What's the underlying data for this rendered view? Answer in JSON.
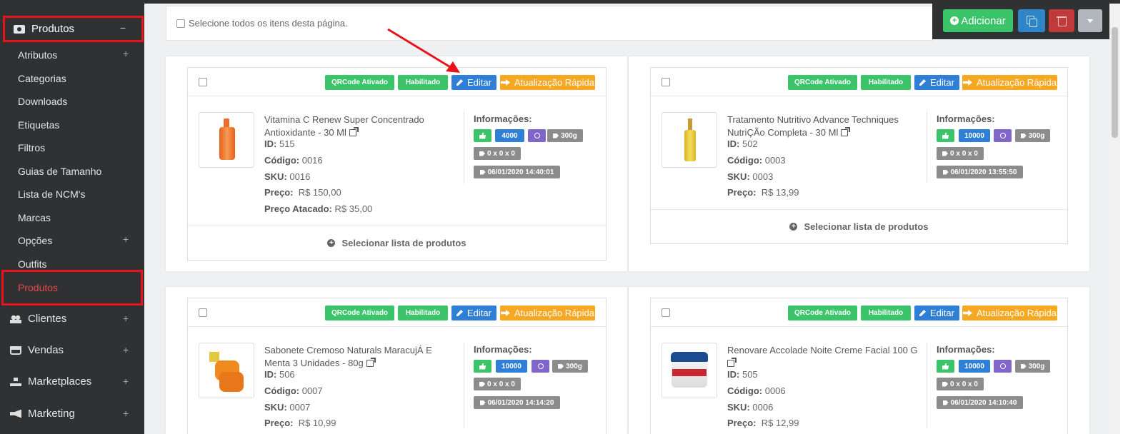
{
  "sidebar": {
    "section_title": "Produtos",
    "section_toggle": "−",
    "sub_items": [
      {
        "label": "Atributos",
        "plus": "+"
      },
      {
        "label": "Categorias",
        "plus": ""
      },
      {
        "label": "Downloads",
        "plus": ""
      },
      {
        "label": "Etiquetas",
        "plus": ""
      },
      {
        "label": "Filtros",
        "plus": ""
      },
      {
        "label": "Guias de Tamanho",
        "plus": ""
      },
      {
        "label": "Lista de NCM's",
        "plus": ""
      },
      {
        "label": "Marcas",
        "plus": ""
      },
      {
        "label": "Opções",
        "plus": "+"
      },
      {
        "label": "Outfits",
        "plus": ""
      }
    ],
    "active_item": "Produtos",
    "main_items": [
      {
        "label": "Clientes",
        "icon": "users-icon",
        "plus": "+"
      },
      {
        "label": "Vendas",
        "icon": "cart-icon",
        "plus": "+"
      },
      {
        "label": "Marketplaces",
        "icon": "sitemap-icon",
        "plus": "+"
      },
      {
        "label": "Marketing",
        "icon": "bullhorn-icon",
        "plus": "+"
      }
    ]
  },
  "select_all_label": "Selecione todos os itens desta página.",
  "toolbar": {
    "add_label": "Adicionar",
    "add_color": "#3cc46b",
    "copy_color": "#2e86c8",
    "delete_color": "#c0393b"
  },
  "card_labels": {
    "qrcode": "QRCode Ativado",
    "enabled": "Habilitado",
    "edit": "Editar",
    "quick_update": "Atualização Rápida",
    "info_title": "Informações:",
    "id_label": "ID:",
    "code_label": "Código:",
    "sku_label": "SKU:",
    "price_label": "Preço:",
    "wholesale_label": "Preço Atacado:",
    "select_list": "Selecionar lista de produtos"
  },
  "products": [
    {
      "name": "Vitamina C Renew Super Concentrado Antioxidante - 30 Ml",
      "id": "515",
      "code": "0016",
      "sku": "0016",
      "price": "R$ 150,00",
      "wholesale": "R$ 35,00",
      "stock": "4000",
      "weight": "300g",
      "dimensions": "0 x 0 x 0",
      "date": "06/01/2020 14:40:01"
    },
    {
      "name": "Tratamento Nutritivo Advance Techniques NutriÇÃo Completa - 30 Ml",
      "id": "502",
      "code": "0003",
      "sku": "0003",
      "price": "R$ 13,99",
      "stock": "10000",
      "weight": "300g",
      "dimensions": "0 x 0 x 0",
      "date": "06/01/2020 13:55:50"
    },
    {
      "name": "Sabonete Cremoso Naturals MaracujÁ E Menta 3 Unidades - 80g",
      "id": "506",
      "code": "0007",
      "sku": "0007",
      "price": "R$ 10,99",
      "stock": "10000",
      "weight": "300g",
      "dimensions": "0 x 0 x 0",
      "date": "06/01/2020 14:14:20"
    },
    {
      "name": "Renovare Accolade Noite Creme Facial 100 G",
      "id": "505",
      "code": "0006",
      "sku": "0006",
      "price": "R$ 12,99",
      "stock": "10000",
      "weight": "300g",
      "dimensions": "0 x 0 x 0",
      "date": "06/01/2020 14:10:40"
    }
  ],
  "colors": {
    "sidebar_bg": "#2f3132",
    "highlight_red": "#e8141c",
    "badge_green": "#3cc46b",
    "edit_blue": "#2f7fd6",
    "quick_orange": "#f7a823",
    "chip_purple": "#8166c9",
    "chip_gray": "#8c8c8c"
  }
}
